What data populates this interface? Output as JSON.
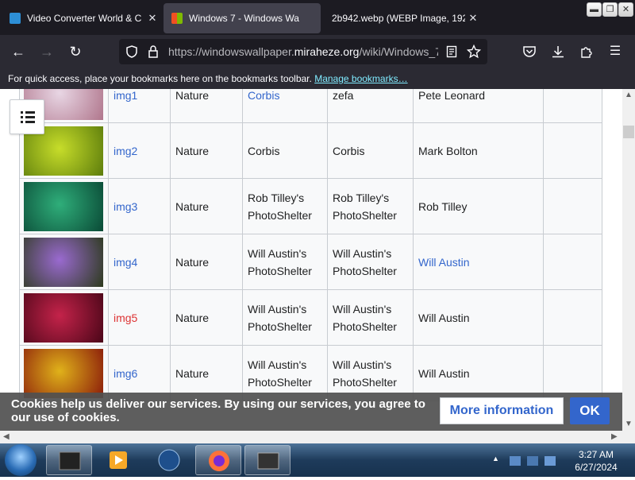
{
  "browser": {
    "tabs": [
      {
        "title": "Video Converter World & C",
        "active": false,
        "icon_name": "video-converter-favicon"
      },
      {
        "title": "Windows 7 - Windows Wa",
        "active": true,
        "icon_name": "windows-wallpaper-favicon"
      },
      {
        "title": "2b942.webp (WEBP Image, 192",
        "active": false,
        "icon_name": "image-favicon"
      }
    ],
    "url_prefix": "https://windowswallpaper.",
    "url_domain": "miraheze.org",
    "url_suffix": "/wiki/Windows_7",
    "bookmarks_text": "For quick access, place your bookmarks here on the bookmarks toolbar.",
    "bookmarks_link": "Manage bookmarks…"
  },
  "table": {
    "rows": [
      {
        "name": "img1",
        "category": "Nature",
        "c3": "Corbis",
        "c4": "zefa",
        "c5": "Pete Leonard",
        "name_style": "link",
        "c3_link": true,
        "c5_link": false,
        "thumb": [
          "#e8d6e4",
          "#b0768c"
        ]
      },
      {
        "name": "img2",
        "category": "Nature",
        "c3": "Corbis",
        "c4": "Corbis",
        "c5": "Mark Bolton",
        "name_style": "link",
        "c3_link": false,
        "c5_link": false,
        "thumb": [
          "#c7dd2a",
          "#5d7d0c"
        ]
      },
      {
        "name": "img3",
        "category": "Nature",
        "c3": "Rob Tilley's PhotoShelter",
        "c4": "Rob Tilley's PhotoShelter",
        "c5": "Rob Tilley",
        "name_style": "link",
        "c3_link": false,
        "c5_link": false,
        "thumb": [
          "#2fae7a",
          "#0a4a36"
        ]
      },
      {
        "name": "img4",
        "category": "Nature",
        "c3": "Will Austin's PhotoShelter",
        "c4": "Will Austin's PhotoShelter",
        "c5": "Will Austin",
        "name_style": "link",
        "c3_link": false,
        "c5_link": true,
        "thumb": [
          "#9a6ad0",
          "#2c3a1c"
        ]
      },
      {
        "name": "img5",
        "category": "Nature",
        "c3": "Will Austin's PhotoShelter",
        "c4": "Will Austin's PhotoShelter",
        "c5": "Will Austin",
        "name_style": "red",
        "c3_link": false,
        "c5_link": false,
        "thumb": [
          "#c4234a",
          "#4a0618"
        ]
      },
      {
        "name": "img6",
        "category": "Nature",
        "c3": "Will Austin's PhotoShelter",
        "c4": "Will Austin's PhotoShelter",
        "c5": "Will Austin",
        "name_style": "link",
        "c3_link": false,
        "c5_link": false,
        "thumb": [
          "#e0b21a",
          "#8a1a0a"
        ]
      }
    ]
  },
  "cookie": {
    "message": "Cookies help us deliver our services. By using our services, you agree to our use of cookies.",
    "more_label": "More information",
    "ok_label": "OK"
  },
  "taskbar": {
    "time": "3:27 AM",
    "date": "6/27/2024"
  },
  "colors": {
    "link": "#3366cc",
    "redlink": "#dd3333",
    "browser_dark": "#1c1b22"
  }
}
